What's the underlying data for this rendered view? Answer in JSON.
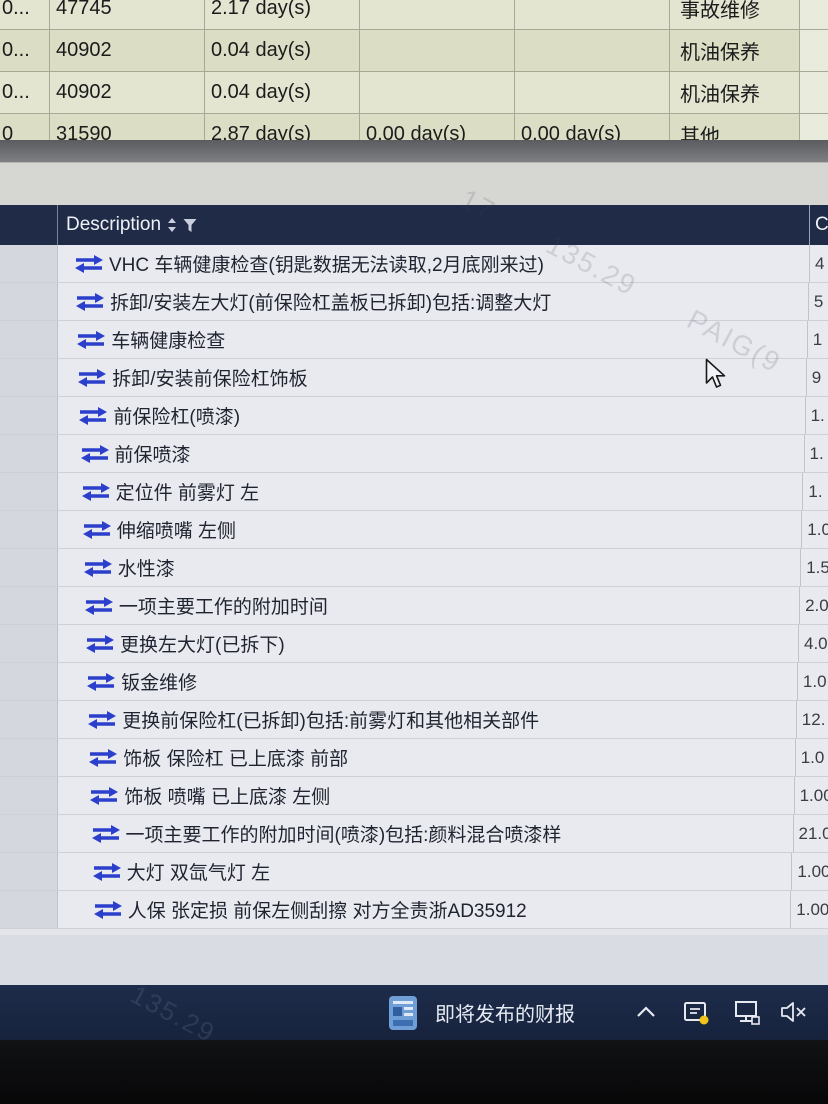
{
  "top_table": {
    "rows": [
      {
        "col1": "0...",
        "col2": "47745",
        "col3": "2.17 day(s)",
        "col4": "",
        "col5": "",
        "col6": "事故维修"
      },
      {
        "col1": "0...",
        "col2": "40902",
        "col3": "0.04 day(s)",
        "col4": "",
        "col5": "",
        "col6": "机油保养"
      },
      {
        "col1": "0...",
        "col2": "40902",
        "col3": "0.04 day(s)",
        "col4": "",
        "col5": "",
        "col6": "机油保养"
      },
      {
        "col1": "0",
        "col2": "31590",
        "col3": "2.87 day(s)",
        "col4": "0.00 day(s)",
        "col5": "0.00 day(s)",
        "col6": "其他"
      }
    ]
  },
  "detail_table": {
    "header": {
      "description": "Description",
      "next_column": "C"
    },
    "rows": [
      {
        "description": "VHC 车辆健康检查(钥匙数据无法读取,2月底刚来过)",
        "value": "4"
      },
      {
        "description": "拆卸/安装左大灯(前保险杠盖板已拆卸)包括:调整大灯",
        "value": "5"
      },
      {
        "description": "车辆健康检查",
        "value": "1"
      },
      {
        "description": "拆卸/安装前保险杠饰板",
        "value": "9"
      },
      {
        "description": "前保险杠(喷漆)",
        "value": "1."
      },
      {
        "description": "前保喷漆",
        "value": "1."
      },
      {
        "description": "定位件 前雾灯 左",
        "value": "1."
      },
      {
        "description": "伸缩喷嘴 左侧",
        "value": "1.0"
      },
      {
        "description": "水性漆",
        "value": "1.5"
      },
      {
        "description": "一项主要工作的附加时间",
        "value": "2.0"
      },
      {
        "description": "更换左大灯(已拆下)",
        "value": "4.0"
      },
      {
        "description": "钣金维修",
        "value": "1.0"
      },
      {
        "description": "更换前保险杠(已拆卸)包括:前雾灯和其他相关部件",
        "value": "12."
      },
      {
        "description": "饰板 保险杠 已上底漆 前部",
        "value": "1.0"
      },
      {
        "description": "饰板 喷嘴 已上底漆 左侧",
        "value": "1.00"
      },
      {
        "description": "一项主要工作的附加时间(喷漆)包括:颜料混合喷漆样",
        "value": "21.0"
      },
      {
        "description": "大灯 双氙气灯 左",
        "value": "1.00"
      },
      {
        "description": "人保 张定损 前保左侧刮擦 对方全责浙AD35912",
        "value": "1.00"
      }
    ]
  },
  "watermark": {
    "pieces": [
      "17",
      "135.29",
      "PAIG(9"
    ],
    "taskbar_piece": "135.29"
  },
  "taskbar": {
    "widget_text": "即将发布的财报"
  },
  "icons": {
    "row_action": "swap-icon",
    "header_sort": "sort-icon",
    "header_filter": "filter-icon",
    "pointer": "mouse-cursor-icon",
    "taskbar": [
      "news-widget-icon",
      "chevron-up-icon",
      "tray-app-icon",
      "network-icon",
      "speaker-muted-icon"
    ]
  },
  "colors": {
    "header_bg": "#1f2b47",
    "swap_icon": "#2b3fcc",
    "taskbar_bg": "#1b2a47",
    "top_table_bg": "#e3e5d1",
    "detail_row_bg": "#e8eaef"
  }
}
